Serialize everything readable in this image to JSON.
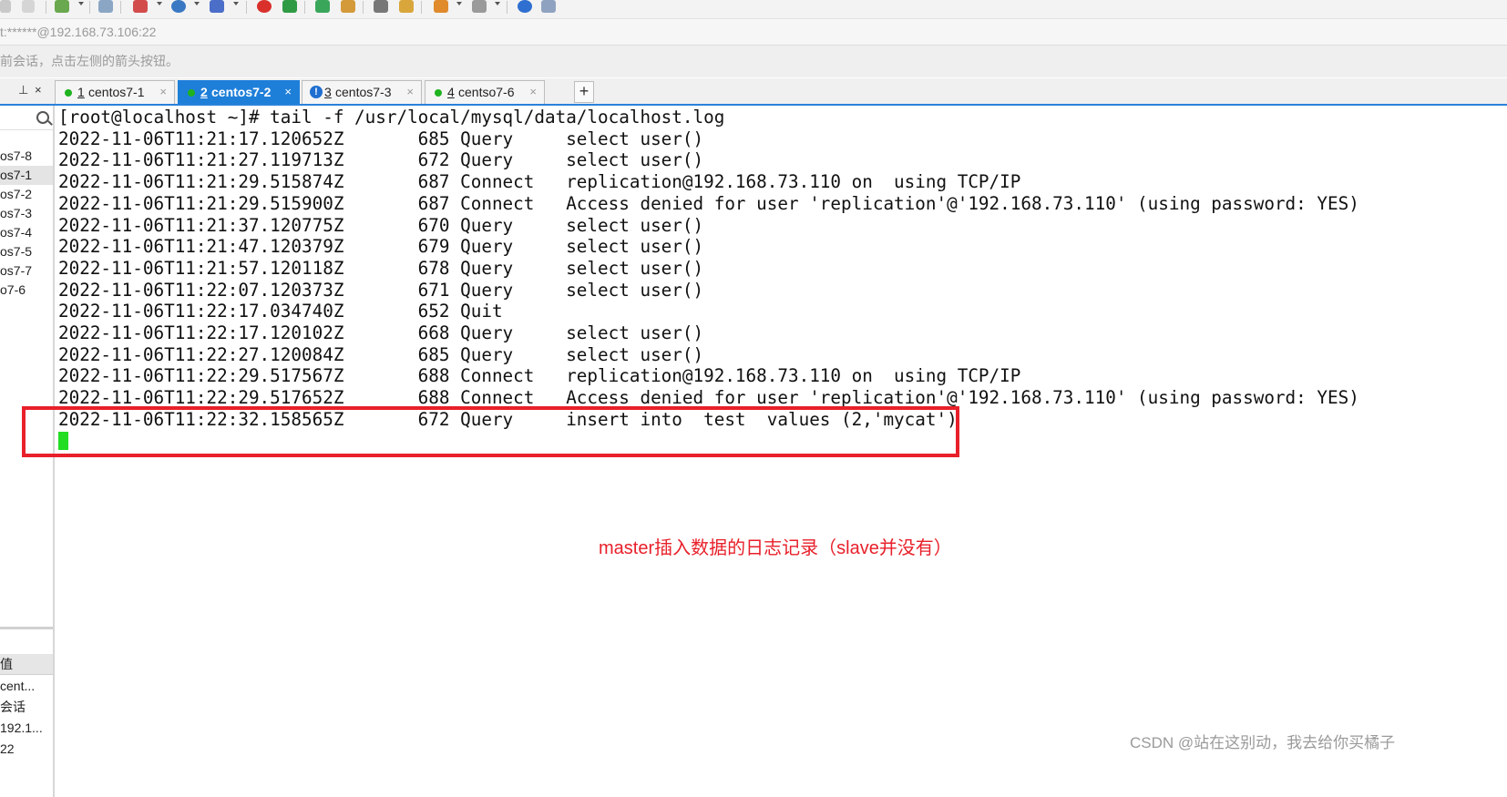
{
  "address": {
    "text": "t:******@192.168.73.106:22"
  },
  "hint": {
    "text": "前会话，点击左侧的箭头按钮。"
  },
  "tabs": [
    {
      "num": "1",
      "label": "centos7-1",
      "status": "connected",
      "active": false
    },
    {
      "num": "2",
      "label": "centos7-2",
      "status": "connected",
      "active": true
    },
    {
      "num": "3",
      "label": "centos7-3",
      "status": "warning",
      "active": false
    },
    {
      "num": "4",
      "label": "centso7-6",
      "status": "connected",
      "active": false
    }
  ],
  "tab_close_glyph": "×",
  "add_tab_glyph": "+",
  "pane_controls": {
    "pin": "⊥",
    "close": "×"
  },
  "sessions": [
    "os7-8",
    "os7-1",
    "os7-2",
    "os7-3",
    "os7-4",
    "os7-5",
    "os7-7",
    "o7-6"
  ],
  "properties": {
    "header": "值",
    "items": [
      "cent...",
      "会话",
      "192.1...",
      "22"
    ]
  },
  "terminal": {
    "lines": [
      "[root@localhost ~]# tail -f /usr/local/mysql/data/localhost.log",
      "2022-11-06T11:21:17.120652Z       685 Query     select user()",
      "2022-11-06T11:21:27.119713Z       672 Query     select user()",
      "2022-11-06T11:21:29.515874Z       687 Connect   replication@192.168.73.110 on  using TCP/IP",
      "2022-11-06T11:21:29.515900Z       687 Connect   Access denied for user 'replication'@'192.168.73.110' (using password: YES)",
      "2022-11-06T11:21:37.120775Z       670 Query     select user()",
      "2022-11-06T11:21:47.120379Z       679 Query     select user()",
      "2022-11-06T11:21:57.120118Z       678 Query     select user()",
      "2022-11-06T11:22:07.120373Z       671 Query     select user()",
      "2022-11-06T11:22:17.034740Z       652 Quit",
      "2022-11-06T11:22:17.120102Z       668 Query     select user()",
      "2022-11-06T11:22:27.120084Z       685 Query     select user()",
      "2022-11-06T11:22:29.517567Z       688 Connect   replication@192.168.73.110 on  using TCP/IP",
      "2022-11-06T11:22:29.517652Z       688 Connect   Access denied for user 'replication'@'192.168.73.110' (using password: YES)",
      "2022-11-06T11:22:32.158565Z       672 Query     insert into  test  values (2,'mycat')"
    ]
  },
  "annotation": "master插入数据的日志记录（slave并没有）",
  "watermark": "CSDN @站在这别动，我去给你买橘子",
  "colors": {
    "accent": "#1e7fd9",
    "highlight": "#e8202a",
    "cursor": "#22dd22",
    "status_connected": "#1fb31f"
  }
}
